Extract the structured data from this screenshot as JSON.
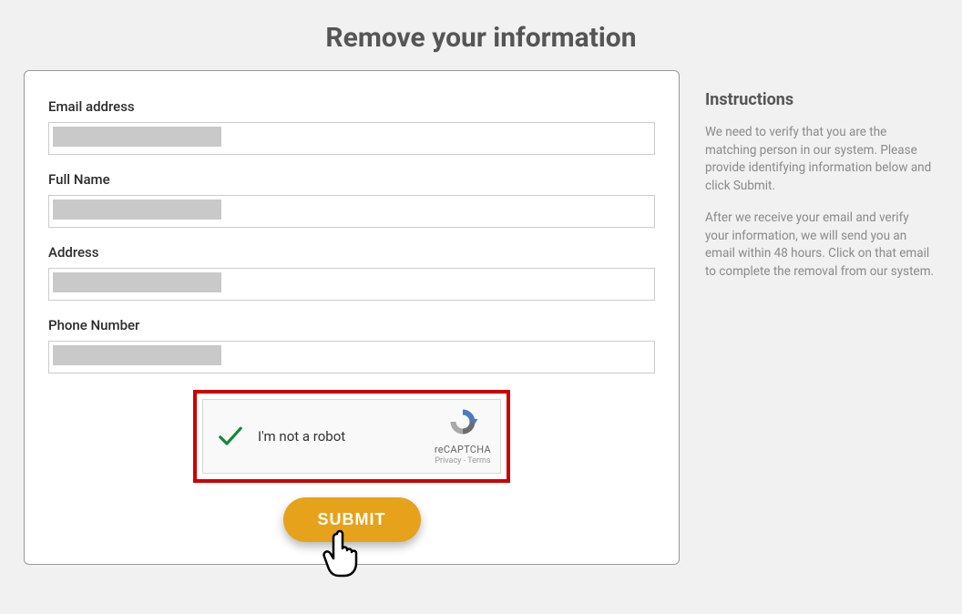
{
  "title": "Remove your information",
  "form": {
    "fields": {
      "email": {
        "label": "Email address",
        "value": ""
      },
      "fullname": {
        "label": "Full Name",
        "value": ""
      },
      "address": {
        "label": "Address",
        "value": ""
      },
      "phone": {
        "label": "Phone Number",
        "value": ""
      }
    },
    "captcha": {
      "label": "I'm not a robot",
      "brand": "reCAPTCHA",
      "privacy": "Privacy",
      "terms": "Terms",
      "checked": true
    },
    "submit_label": "SUBMIT"
  },
  "instructions": {
    "heading": "Instructions",
    "paragraph1": "We need to verify that you are the matching person in our system. Please provide identifying information below and click Submit.",
    "paragraph2": "After we receive your email and verify your information, we will send you an email within 48 hours. Click on that email to complete the removal from our system."
  }
}
